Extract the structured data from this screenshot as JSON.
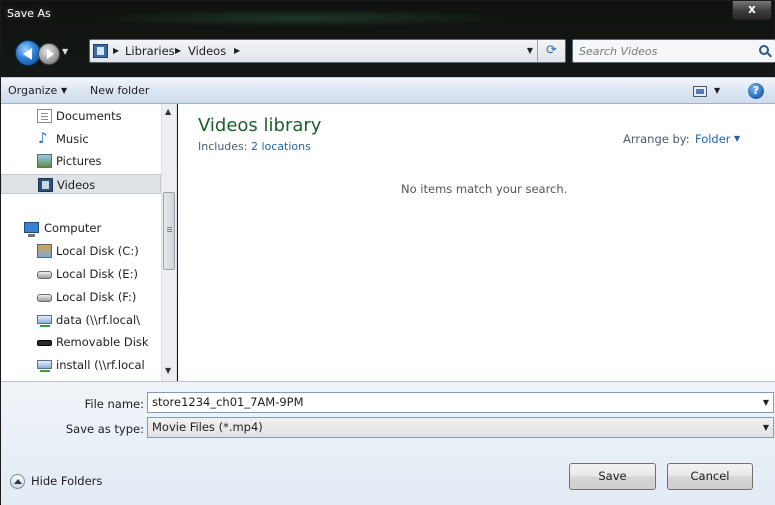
{
  "window": {
    "title": "Save As",
    "close_label": "x"
  },
  "nav": {
    "breadcrumbs": [
      "Libraries",
      "Videos"
    ],
    "search_placeholder": "Search Videos"
  },
  "toolbar": {
    "organize": "Organize",
    "new_folder": "New folder",
    "help": "?"
  },
  "sidebar": {
    "items": [
      {
        "label": "Documents",
        "icon": "documents-icon"
      },
      {
        "label": "Music",
        "icon": "music-icon"
      },
      {
        "label": "Pictures",
        "icon": "pictures-icon"
      },
      {
        "label": "Videos",
        "icon": "videos-icon",
        "selected": true
      },
      {
        "label": "Computer",
        "icon": "computer-icon"
      },
      {
        "label": "Local Disk (C:)",
        "icon": "drive-c-icon"
      },
      {
        "label": "Local Disk (E:)",
        "icon": "drive-icon"
      },
      {
        "label": "Local Disk (F:)",
        "icon": "drive-icon"
      },
      {
        "label": "data (\\\\rf.local\\",
        "icon": "network-drive-icon"
      },
      {
        "label": "Removable Disk",
        "icon": "removable-disk-icon"
      },
      {
        "label": "install (\\\\rf.local",
        "icon": "network-drive-icon"
      }
    ]
  },
  "content": {
    "title": "Videos library",
    "includes_label": "Includes:",
    "includes_link": "2 locations",
    "arrange_label": "Arrange by:",
    "arrange_value": "Folder",
    "empty_message": "No items match your search."
  },
  "bottom": {
    "file_name_label": "File name:",
    "file_name_value": "store1234_ch01_7AM-9PM",
    "save_type_label": "Save as type:",
    "save_type_value": "Movie Files (*.mp4)",
    "hide_folders": "Hide Folders",
    "save_button": "Save",
    "cancel_button": "Cancel"
  },
  "colors": {
    "library_title": "#1e5d2c",
    "link": "#1e64b4",
    "toolbar": "#dce6f3"
  }
}
